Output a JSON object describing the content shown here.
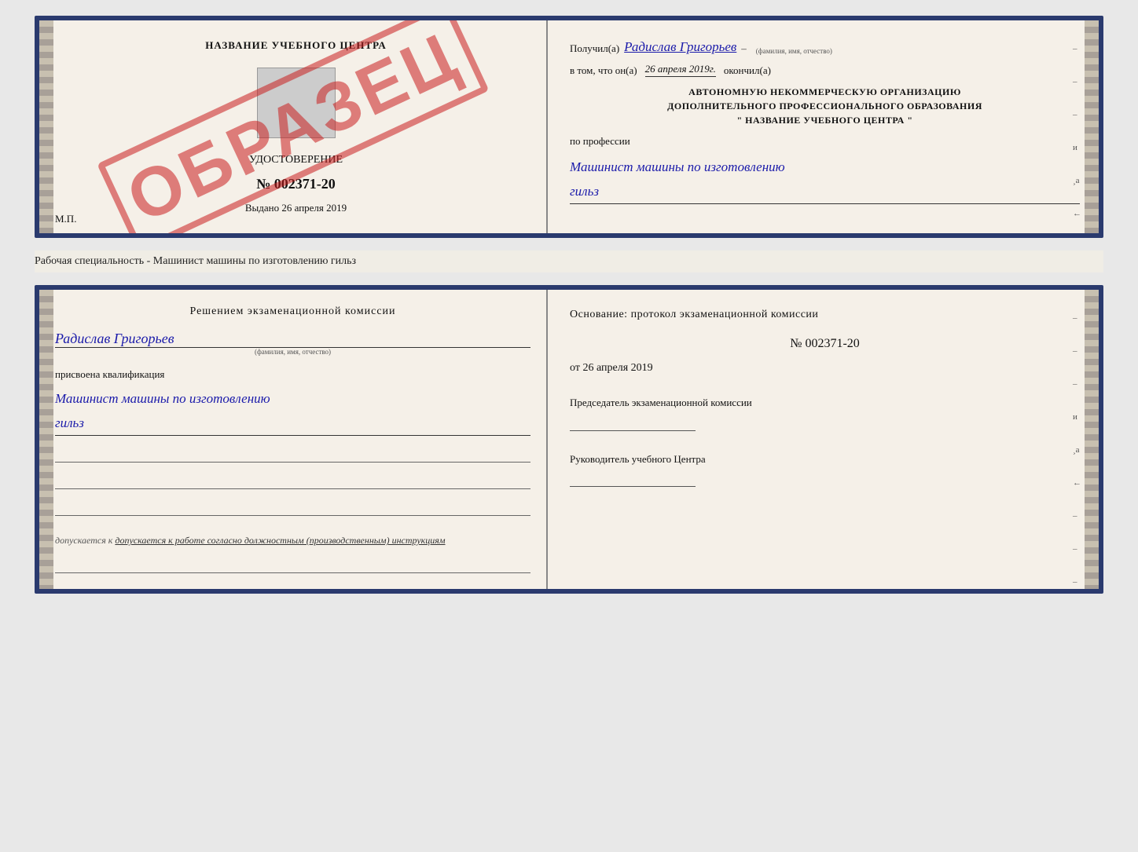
{
  "top_doc": {
    "left": {
      "title": "НАЗВАНИЕ УЧЕБНОГО ЦЕНТРА",
      "cert_label": "УДОСТОВЕРЕНИЕ",
      "cert_number": "№ 002371-20",
      "issued_prefix": "Выдано",
      "issued_date": "26 апреля 2019",
      "mp_label": "М.П.",
      "watermark": "ОБРАЗЕЦ"
    },
    "right": {
      "received_prefix": "Получил(а)",
      "recipient_name": "Радислав Григорьев",
      "recipient_name_label": "(фамилия, имя, отчество)",
      "completed_prefix": "в том, что он(а)",
      "completed_date": "26 апреля 2019г.",
      "completed_suffix": "окончил(а)",
      "org_line1": "АВТОНОМНУЮ НЕКОММЕРЧЕСКУЮ ОРГАНИЗАЦИЮ",
      "org_line2": "ДОПОЛНИТЕЛЬНОГО ПРОФЕССИОНАЛЬНОГО ОБРАЗОВАНИЯ",
      "org_line3": "\"  НАЗВАНИЕ УЧЕБНОГО ЦЕНТРА  \"",
      "profession_prefix": "по профессии",
      "profession_name": "Машинист машины по изготовлению",
      "profession_name2": "гильз"
    }
  },
  "subtitle": "Рабочая специальность - Машинист машины по изготовлению гильз",
  "bottom_doc": {
    "left": {
      "resolution_title": "Решением  экзаменационной  комиссии",
      "person_name": "Радислав Григорьев",
      "person_name_label": "(фамилия, имя, отчество)",
      "qual_prefix": "присвоена квалификация",
      "qual_name": "Машинист машины по изготовлению",
      "qual_name2": "гильз",
      "allow_text": "допускается к  работе согласно должностным (производственным) инструкциям"
    },
    "right": {
      "basis_title": "Основание: протокол экзаменационной  комиссии",
      "protocol_number": "№  002371-20",
      "protocol_date_prefix": "от",
      "protocol_date": "26 апреля 2019",
      "chairman_title": "Председатель экзаменационной комиссии",
      "director_title": "Руководитель учебного Центра"
    }
  }
}
